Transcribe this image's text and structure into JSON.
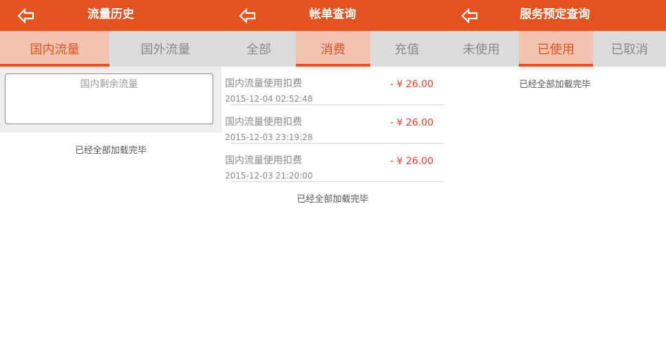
{
  "colors": {
    "brand": "#e1531f",
    "amount": "#e0432d",
    "tabbar": "#dcdcdc",
    "tab_active_bg": "#f1c3b0"
  },
  "icons": {
    "back": "back-arrow-icon"
  },
  "panels": [
    {
      "title": "流量历史",
      "tabs": [
        {
          "label": "国内流量",
          "active": true
        },
        {
          "label": "国外流量",
          "active": false
        }
      ],
      "remaining_label": "国内剩余流量",
      "status": "已经全部加载完毕"
    },
    {
      "title": "帐单查询",
      "tabs": [
        {
          "label": "全部",
          "active": false
        },
        {
          "label": "消费",
          "active": true
        },
        {
          "label": "充值",
          "active": false
        }
      ],
      "records": [
        {
          "name": "国内流量使用扣费",
          "amount": "- ¥ 26.00",
          "time": "2015-12-04 02:52:48"
        },
        {
          "name": "国内流量使用扣费",
          "amount": "- ¥ 26.00",
          "time": "2015-12-03 23:19:28"
        },
        {
          "name": "国内流量使用扣费",
          "amount": "- ¥ 26.00",
          "time": "2015-12-03 21:20:00"
        }
      ],
      "status": "已经全部加载完毕"
    },
    {
      "title": "服务预定查询",
      "tabs": [
        {
          "label": "未使用",
          "active": false
        },
        {
          "label": "已使用",
          "active": true
        },
        {
          "label": "已取消",
          "active": false
        }
      ],
      "status": "已经全部加载完毕"
    }
  ]
}
